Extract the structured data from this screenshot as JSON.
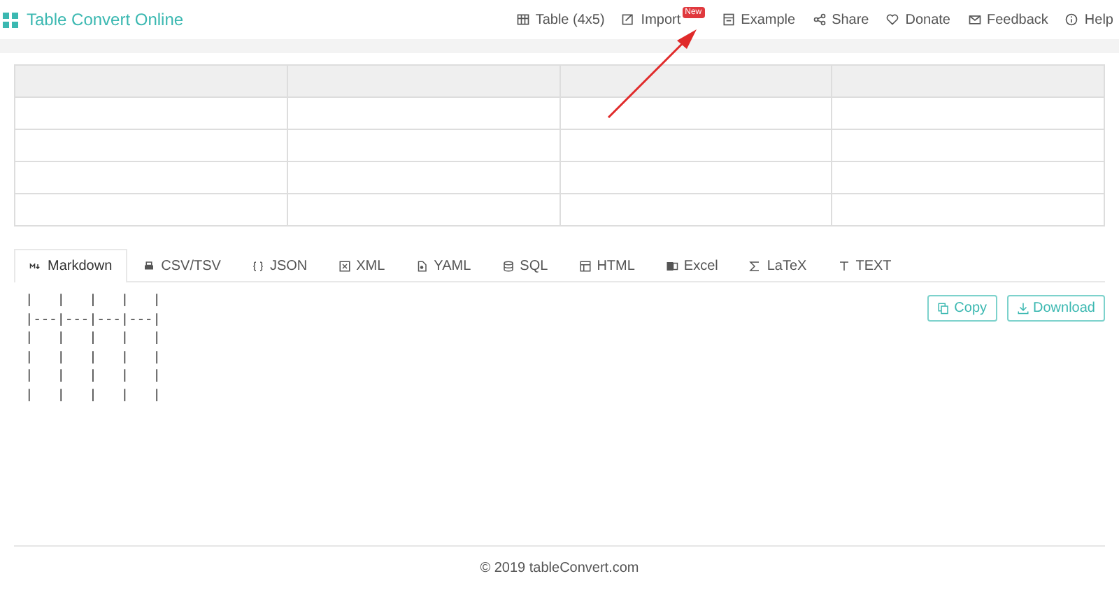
{
  "header": {
    "title": "Table Convert Online",
    "nav": [
      {
        "label": "Table (4x5)"
      },
      {
        "label": "Import",
        "badge": "New"
      },
      {
        "label": "Example"
      },
      {
        "label": "Share"
      },
      {
        "label": "Donate"
      },
      {
        "label": "Feedback"
      },
      {
        "label": "Help"
      }
    ]
  },
  "tabs": [
    {
      "label": "Markdown",
      "selected": true
    },
    {
      "label": "CSV/TSV",
      "selected": false
    },
    {
      "label": "JSON",
      "selected": false
    },
    {
      "label": "XML",
      "selected": false
    },
    {
      "label": "YAML",
      "selected": false
    },
    {
      "label": "SQL",
      "selected": false
    },
    {
      "label": "HTML",
      "selected": false
    },
    {
      "label": "Excel",
      "selected": false
    },
    {
      "label": "LaTeX",
      "selected": false
    },
    {
      "label": "TEXT",
      "selected": false
    }
  ],
  "output": {
    "lines": [
      "|   |   |   |   |",
      "|---|---|---|---|",
      "|   |   |   |   |",
      "|   |   |   |   |",
      "|   |   |   |   |",
      "|   |   |   |   |"
    ]
  },
  "buttons": [
    "Copy",
    "Download"
  ],
  "footer": "© 2019 tableConvert.com"
}
